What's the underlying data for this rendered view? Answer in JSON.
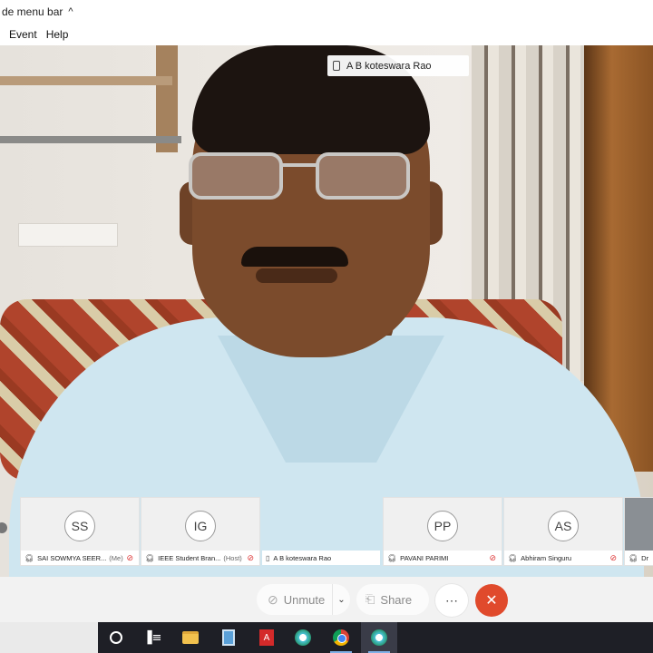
{
  "menu_toggle": {
    "label": "de menu bar",
    "chevron": "^"
  },
  "menubar": {
    "items": [
      "Event",
      "Help"
    ]
  },
  "active_speaker": {
    "name": "A B koteswara Rao",
    "icon": "mobile-device-icon"
  },
  "participants": [
    {
      "initials": "SS",
      "name": "SAI SOWMYA SEER...",
      "role": "(Me)",
      "audio_icon": "headset-icon",
      "mic_icon": "mic-muted-icon"
    },
    {
      "initials": "IG",
      "name": "IEEE Student Bran...",
      "role": "(Host)",
      "audio_icon": "headset-icon",
      "mic_icon": "mic-muted-icon"
    },
    {
      "initials": "",
      "name": "A B koteswara Rao",
      "role": "",
      "audio_icon": "mobile-device-icon",
      "mic_icon": ""
    },
    {
      "initials": "PP",
      "name": "PAVANI PARIMI",
      "role": "",
      "audio_icon": "headset-icon",
      "mic_icon": "mic-muted-icon"
    },
    {
      "initials": "AS",
      "name": "Abhiram Singuru",
      "role": "",
      "audio_icon": "headset-icon",
      "mic_icon": "mic-muted-icon"
    },
    {
      "initials": "",
      "name": "Dr",
      "role": "",
      "audio_icon": "headset-icon",
      "mic_icon": ""
    }
  ],
  "controls": {
    "unmute_label": "Unmute",
    "share_label": "Share",
    "more_label": "⋯",
    "end_label": "✕",
    "end_color": "#e04a2c"
  },
  "taskbar": {
    "icons": [
      "cortana-search-icon",
      "task-view-icon",
      "file-explorer-icon",
      "calculator-icon",
      "pdf-reader-icon",
      "webex-icon",
      "chrome-icon",
      "webex-meeting-icon"
    ]
  }
}
